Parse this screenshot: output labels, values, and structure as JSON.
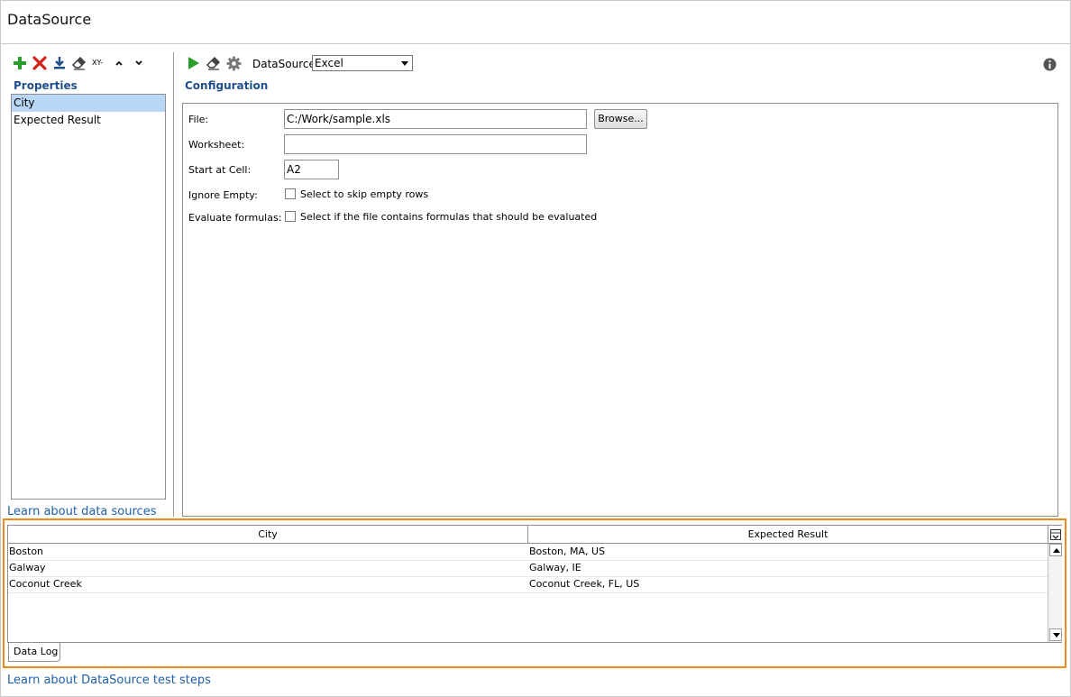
{
  "window": {
    "title": "DataSource"
  },
  "properties": {
    "label": "Properties",
    "items": [
      "City",
      "Expected Result"
    ],
    "learn_link": "Learn about data sources",
    "toolbar_icons": [
      "add-icon",
      "delete-icon",
      "download-icon",
      "eraser-icon",
      "xy-icon",
      "move-up-icon",
      "move-down-icon"
    ],
    "xy_label": "XY-"
  },
  "config": {
    "label": "Configuration",
    "toolbar_icons": [
      "run-icon",
      "eraser-icon",
      "gear-icon",
      "info-icon"
    ],
    "datasource_label": "DataSource:",
    "datasource_value": "Excel",
    "file_label": "File:",
    "file_value": "C:/Work/sample.xls",
    "browse_label": "Browse...",
    "worksheet_label": "Worksheet:",
    "worksheet_value": "",
    "start_cell_label": "Start at Cell:",
    "start_cell_value": "A2",
    "ignore_empty_label": "Ignore Empty:",
    "ignore_empty_text": "Select to skip empty rows",
    "ignore_empty_checked": false,
    "evaluate_label": "Evaluate formulas:",
    "evaluate_text": "Select if the file contains formulas that should be evaluated",
    "evaluate_checked": false
  },
  "data_grid": {
    "columns": [
      "City",
      "Expected Result"
    ],
    "rows": [
      [
        "Boston",
        "Boston, MA, US"
      ],
      [
        "Galway",
        "Galway, IE"
      ],
      [
        "Coconut Creek",
        "Coconut Creek, FL, US"
      ]
    ],
    "tab_label": "Data Log"
  },
  "footer": {
    "learn_link": "Learn about DataSource test steps"
  },
  "colors": {
    "accent_orange": "#f08a1c",
    "link_blue": "#1f5fa6",
    "selection": "#b8d6f5",
    "section_label": "#1f4e8c"
  }
}
